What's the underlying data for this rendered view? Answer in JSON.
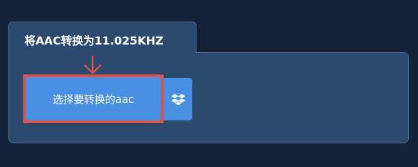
{
  "tab": {
    "title": "将AAC转换为11.025KHZ"
  },
  "upload": {
    "label": "选择要转换的aac"
  },
  "icons": {
    "arrow": "arrow-down-icon",
    "dropbox": "dropbox-icon"
  },
  "colors": {
    "page_background": "#142338",
    "panel_background": "#2c4a6e",
    "panel_border": "#4a6b92",
    "button": "#4a90e2",
    "highlight": "#d9534f",
    "text": "#ffffff"
  }
}
